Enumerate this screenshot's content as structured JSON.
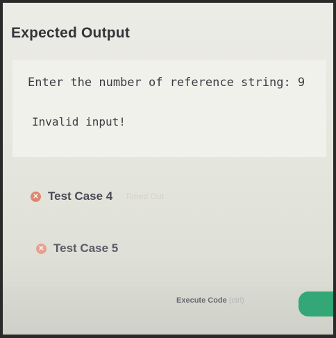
{
  "section": {
    "title": "Expected Output"
  },
  "output": {
    "lines": [
      "Enter the number of reference string: 9",
      "Invalid input!"
    ]
  },
  "test_cases": [
    {
      "label": "Test Case 4",
      "status": "Timed Out",
      "status_icon": "x-circle-icon"
    },
    {
      "label": "Test Case 5",
      "status": "",
      "status_icon": "x-circle-icon"
    }
  ],
  "footer": {
    "execute_label": "Execute Code",
    "execute_hint": "(ctrl)"
  },
  "colors": {
    "error_icon": "#e08570",
    "accent_green": "#34a776"
  }
}
